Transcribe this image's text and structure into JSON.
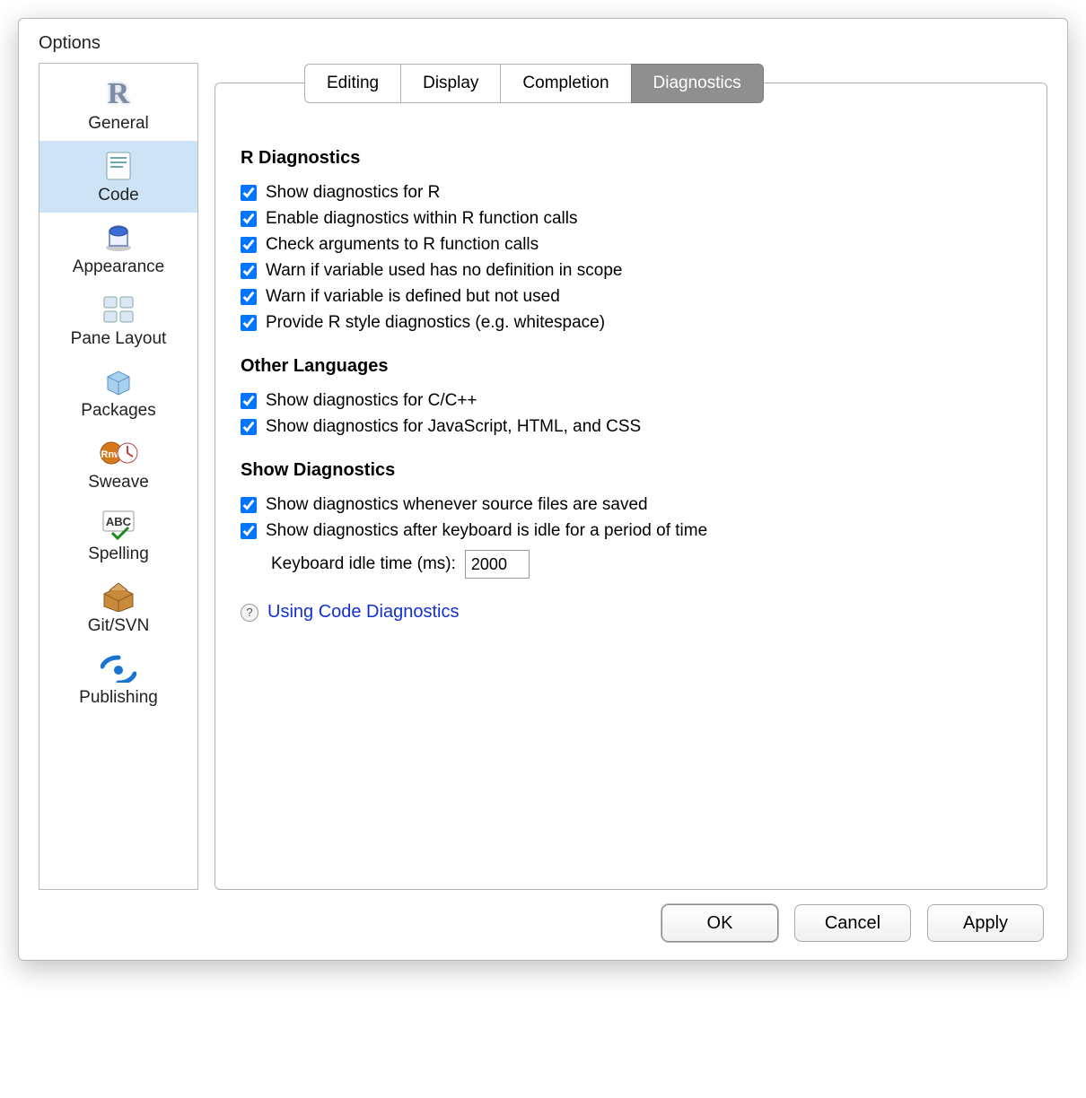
{
  "dialog": {
    "title": "Options"
  },
  "sidebar": {
    "items": [
      {
        "key": "general",
        "label": "General"
      },
      {
        "key": "code",
        "label": "Code"
      },
      {
        "key": "appearance",
        "label": "Appearance"
      },
      {
        "key": "pane-layout",
        "label": "Pane Layout"
      },
      {
        "key": "packages",
        "label": "Packages"
      },
      {
        "key": "sweave",
        "label": "Sweave"
      },
      {
        "key": "spelling",
        "label": "Spelling"
      },
      {
        "key": "git-svn",
        "label": "Git/SVN"
      },
      {
        "key": "publishing",
        "label": "Publishing"
      }
    ],
    "selected": "code"
  },
  "tabs": {
    "items": [
      {
        "key": "editing",
        "label": "Editing"
      },
      {
        "key": "display",
        "label": "Display"
      },
      {
        "key": "completion",
        "label": "Completion"
      },
      {
        "key": "diagnostics",
        "label": "Diagnostics"
      }
    ],
    "selected": "diagnostics"
  },
  "sections": {
    "r_diag": {
      "title": "R Diagnostics",
      "opts": [
        {
          "key": "show_r",
          "label": "Show diagnostics for R",
          "checked": true
        },
        {
          "key": "within_calls",
          "label": "Enable diagnostics within R function calls",
          "checked": true
        },
        {
          "key": "check_args",
          "label": "Check arguments to R function calls",
          "checked": true
        },
        {
          "key": "warn_no_def",
          "label": "Warn if variable used has no definition in scope",
          "checked": true
        },
        {
          "key": "warn_unused",
          "label": "Warn if variable is defined but not used",
          "checked": true
        },
        {
          "key": "style",
          "label": "Provide R style diagnostics (e.g. whitespace)",
          "checked": true
        }
      ]
    },
    "other_lang": {
      "title": "Other Languages",
      "opts": [
        {
          "key": "cpp",
          "label": "Show diagnostics for C/C++",
          "checked": true
        },
        {
          "key": "web",
          "label": "Show diagnostics for JavaScript, HTML, and CSS",
          "checked": true
        }
      ]
    },
    "show_diag": {
      "title": "Show Diagnostics",
      "opts": [
        {
          "key": "on_save",
          "label": "Show diagnostics whenever source files are saved",
          "checked": true
        },
        {
          "key": "on_idle",
          "label": "Show diagnostics after keyboard is idle for a period of time",
          "checked": true
        }
      ],
      "idle_label": "Keyboard idle time (ms):",
      "idle_value": "2000"
    }
  },
  "help": {
    "link_text": "Using Code Diagnostics"
  },
  "buttons": {
    "ok": "OK",
    "cancel": "Cancel",
    "apply": "Apply"
  }
}
